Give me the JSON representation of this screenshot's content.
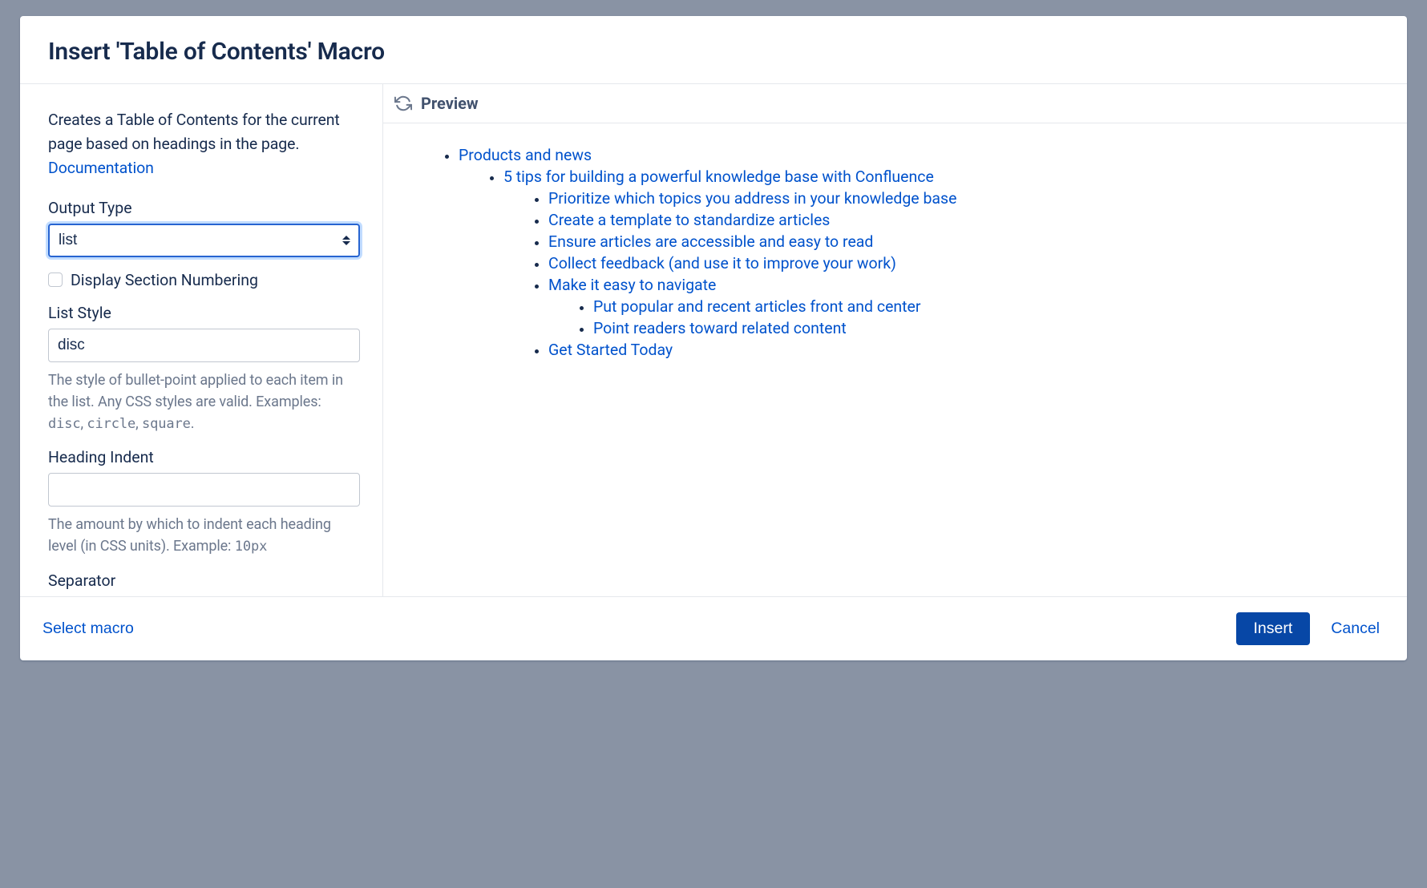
{
  "dialog": {
    "title": "Insert 'Table of Contents' Macro"
  },
  "sidebar": {
    "description_prefix": "Creates a Table of Contents for the current page based on headings in the page. ",
    "documentation_link_label": "Documentation",
    "fields": {
      "output_type": {
        "label": "Output Type",
        "value": "list"
      },
      "display_section_numbering": {
        "label": "Display Section Numbering",
        "checked": false
      },
      "list_style": {
        "label": "List Style",
        "value": "disc",
        "help_prefix": "The style of bullet-point applied to each item in the list. Any CSS styles are valid. Examples: ",
        "help_codes": [
          "disc",
          "circle",
          "square"
        ]
      },
      "heading_indent": {
        "label": "Heading Indent",
        "value": "",
        "help_prefix": "The amount by which to indent each heading level (in CSS units). Example: ",
        "help_code": "10px"
      },
      "separator": {
        "label": "Separator"
      }
    }
  },
  "preview": {
    "title": "Preview",
    "toc": [
      {
        "label": "Products and news",
        "children": [
          {
            "label": "5 tips for building a powerful knowledge base with Confluence",
            "children": [
              {
                "label": "Prioritize which topics you address in your knowledge base"
              },
              {
                "label": "Create a template to standardize articles"
              },
              {
                "label": "Ensure articles are accessible and easy to read"
              },
              {
                "label": "Collect feedback (and use it to improve your work)"
              },
              {
                "label": "Make it easy to navigate",
                "children": [
                  {
                    "label": "Put popular and recent articles front and center"
                  },
                  {
                    "label": "Point readers toward related content"
                  }
                ]
              },
              {
                "label": "Get Started Today"
              }
            ]
          }
        ]
      }
    ]
  },
  "footer": {
    "select_macro_label": "Select macro",
    "insert_label": "Insert",
    "cancel_label": "Cancel"
  }
}
